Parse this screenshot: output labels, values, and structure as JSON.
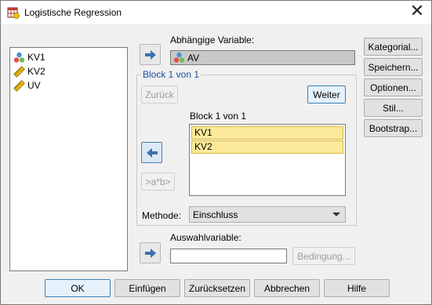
{
  "window": {
    "title": "Logistische Regression",
    "close_glyph": "✕"
  },
  "source_variables": [
    {
      "name": "KV1",
      "icon": "nominal-icon"
    },
    {
      "name": "KV2",
      "icon": "scale-icon"
    },
    {
      "name": "UV",
      "icon": "scale-icon"
    }
  ],
  "dependent": {
    "label": "Abhängige Variable:",
    "value": "AV",
    "icon": "nominal-icon"
  },
  "block": {
    "group_title": "Block 1 von 1",
    "back_label": "Zurück",
    "next_label": "Weiter",
    "list_label": "Block 1 von 1",
    "items": [
      "KV1",
      "KV2"
    ],
    "interaction_label": ">a*b>"
  },
  "method": {
    "label": "Methode:",
    "value": "Einschluss"
  },
  "selection": {
    "label": "Auswahlvariable:",
    "value": "",
    "condition_label": "Bedingung..."
  },
  "side_buttons": [
    "Kategorial...",
    "Speichern...",
    "Optionen...",
    "Stil...",
    "Bootstrap..."
  ],
  "bottom_buttons": [
    "OK",
    "Einfügen",
    "Zurücksetzen",
    "Abbrechen",
    "Hilfe"
  ],
  "colors": {
    "accent_blue": "#3c7fb1",
    "selected_item": "#fde99a",
    "group_title": "#1b4f9c"
  }
}
